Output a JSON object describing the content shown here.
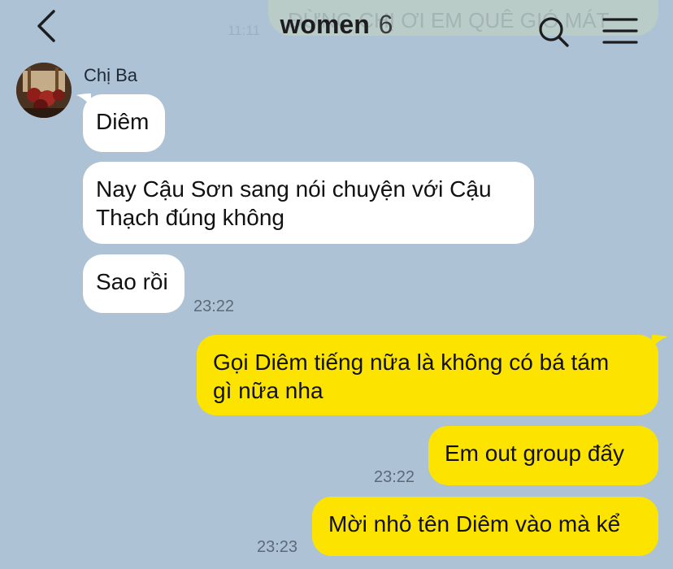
{
  "header": {
    "title": "women",
    "member_count": "6",
    "prev_message_preview": "ĐỪNG CHỊ ƠI EM QUÊ GIÓ MÁT",
    "prev_message_time": "11:11"
  },
  "sender": {
    "name": "Chị Ba"
  },
  "messages": {
    "m1": {
      "text": "Diêm"
    },
    "m2": {
      "text": "Nay Cậu Sơn sang nói chuyện với Cậu\nThạch đúng không"
    },
    "m3": {
      "text": "Sao rồi",
      "time": "23:22"
    },
    "m4": {
      "text": "Gọi Diêm tiếng nữa là không có bá tám\ngì nữa nha"
    },
    "m5": {
      "text": "Em out group đấy",
      "time": "23:22"
    },
    "m6": {
      "text": "Mời nhỏ tên Diêm vào mà kể",
      "time": "23:23"
    }
  },
  "colors": {
    "background": "#aec2d6",
    "incoming_bubble": "#ffffff",
    "outgoing_bubble": "#fde300",
    "timestamp": "#5b6a78"
  },
  "icons": {
    "back": "chevron-left-icon",
    "search": "search-icon",
    "menu": "hamburger-menu-icon"
  }
}
